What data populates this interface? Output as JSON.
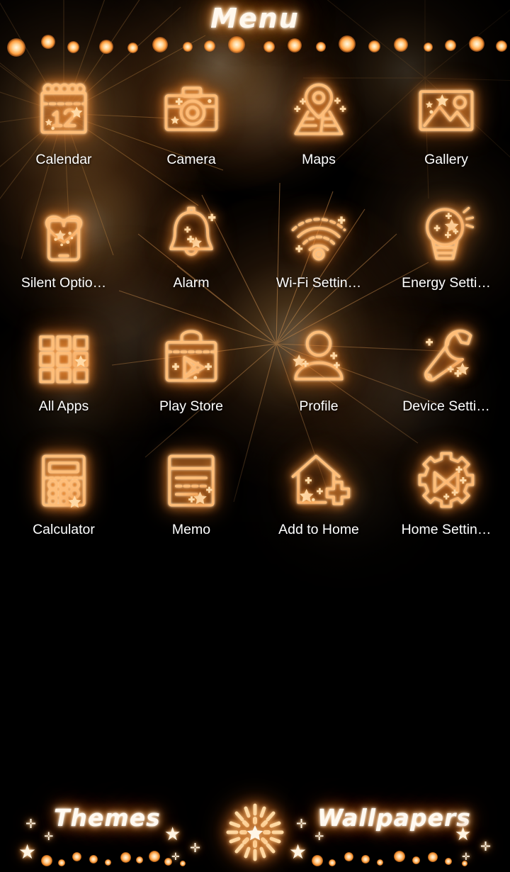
{
  "header": {
    "title": "Menu",
    "decoration": "string-of-lights"
  },
  "theme": {
    "name": "Sparkler Fireworks",
    "background_color": "#000000",
    "icon_stroke_color": "#ffbe79",
    "icon_glow_color": "#ff9a39",
    "label_color": "#ffffff",
    "accent_color": "#ffd9a6"
  },
  "apps": [
    {
      "label": "Calendar",
      "icon": "calendar-icon",
      "row": 1,
      "col": 1
    },
    {
      "label": "Camera",
      "icon": "camera-icon",
      "row": 1,
      "col": 2
    },
    {
      "label": "Maps",
      "icon": "map-pin-icon",
      "row": 1,
      "col": 3
    },
    {
      "label": "Gallery",
      "icon": "gallery-picture-icon",
      "row": 1,
      "col": 4
    },
    {
      "label": "Silent Optio…",
      "icon": "phone-heart-icon",
      "row": 2,
      "col": 1
    },
    {
      "label": "Alarm",
      "icon": "bell-icon",
      "row": 2,
      "col": 2
    },
    {
      "label": "Wi-Fi Settin…",
      "icon": "wifi-icon",
      "row": 2,
      "col": 3
    },
    {
      "label": "Energy Setti…",
      "icon": "lightbulb-icon",
      "row": 2,
      "col": 4
    },
    {
      "label": "All Apps",
      "icon": "app-grid-icon",
      "row": 3,
      "col": 1
    },
    {
      "label": "Play Store",
      "icon": "play-store-bag-icon",
      "row": 3,
      "col": 2
    },
    {
      "label": "Profile",
      "icon": "person-icon",
      "row": 3,
      "col": 3
    },
    {
      "label": "Device Setti…",
      "icon": "wrench-icon",
      "row": 3,
      "col": 4
    },
    {
      "label": "Calculator",
      "icon": "calculator-icon",
      "row": 4,
      "col": 1
    },
    {
      "label": "Memo",
      "icon": "memo-notepad-icon",
      "row": 4,
      "col": 2
    },
    {
      "label": "Add to Home",
      "icon": "house-plus-icon",
      "row": 4,
      "col": 3
    },
    {
      "label": "Home Settin…",
      "icon": "gear-icon",
      "row": 4,
      "col": 4
    }
  ],
  "dock": {
    "themes_label": "Themes",
    "firework_icon": "firework-burst-icon",
    "wallpapers_label": "Wallpapers"
  }
}
